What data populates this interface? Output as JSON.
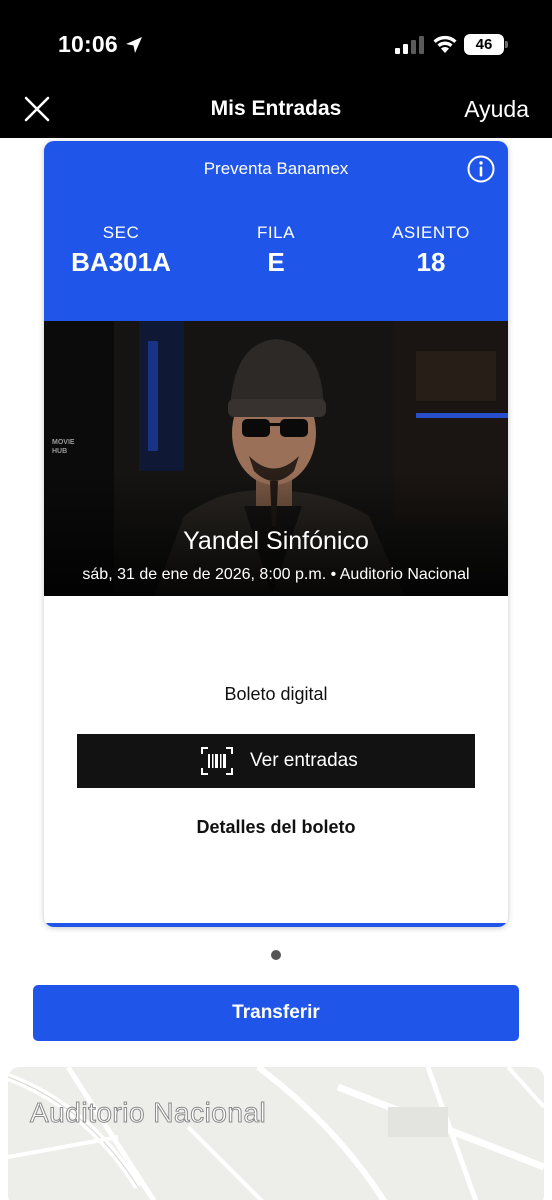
{
  "status_bar": {
    "time": "10:06",
    "battery": "46"
  },
  "nav": {
    "title": "Mis Entradas",
    "help": "Ayuda"
  },
  "ticket": {
    "presale": "Preventa Banamex",
    "section_label": "SEC",
    "section_value": "BA301A",
    "row_label": "FILA",
    "row_value": "E",
    "seat_label": "ASIENTO",
    "seat_value": "18",
    "event_title": "Yandel Sinfónico",
    "event_details": "sáb, 31 de ene de 2026, 8:00 p.m. • Auditorio Nacional",
    "digital_label": "Boleto digital",
    "view_button": "Ver entradas",
    "details_link": "Detalles del boleto",
    "brand_color": "#1f55e8"
  },
  "actions": {
    "transfer": "Transferir"
  },
  "map": {
    "venue_label": "Auditorio Nacional"
  }
}
